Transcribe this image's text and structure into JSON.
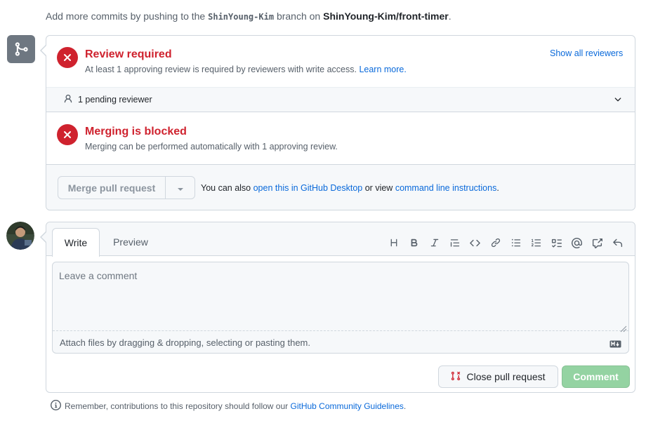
{
  "header": {
    "prefix": "Add more commits by pushing to the",
    "branch": "ShinYoung-Kim",
    "middle": "branch on",
    "repo": "ShinYoung-Kim/front-timer",
    "suffix": "."
  },
  "review": {
    "title": "Review required",
    "description": "At least 1 approving review is required by reviewers with write access.",
    "learn_more": "Learn more.",
    "show_all": "Show all reviewers",
    "pending": "1 pending reviewer"
  },
  "blocked": {
    "title": "Merging is blocked",
    "description": "Merging can be performed automatically with 1 approving review."
  },
  "merge_footer": {
    "button": "Merge pull request",
    "text_before": "You can also",
    "desktop_link": "open this in GitHub Desktop",
    "text_middle": "or view",
    "cli_link": "command line instructions",
    "text_after": "."
  },
  "comment": {
    "tabs": [
      "Write",
      "Preview"
    ],
    "placeholder": "Leave a comment",
    "attach": "Attach files by dragging & dropping, selecting or pasting them.",
    "markdown_badge": "M↓",
    "close_button": "Close pull request",
    "comment_button": "Comment"
  },
  "toolbar_icons": [
    "heading-icon",
    "bold-icon",
    "italic-icon",
    "quote-icon",
    "code-icon",
    "link-icon",
    "unordered-list-icon",
    "ordered-list-icon",
    "task-list-icon",
    "mention-icon",
    "reference-icon",
    "reply-icon"
  ],
  "footer": {
    "text": "Remember, contributions to this repository should follow our",
    "link": "GitHub Community Guidelines",
    "suffix": "."
  },
  "colors": {
    "danger": "#cf222e",
    "link": "#0969da",
    "comment_button_disabled": "#94d3a2"
  }
}
